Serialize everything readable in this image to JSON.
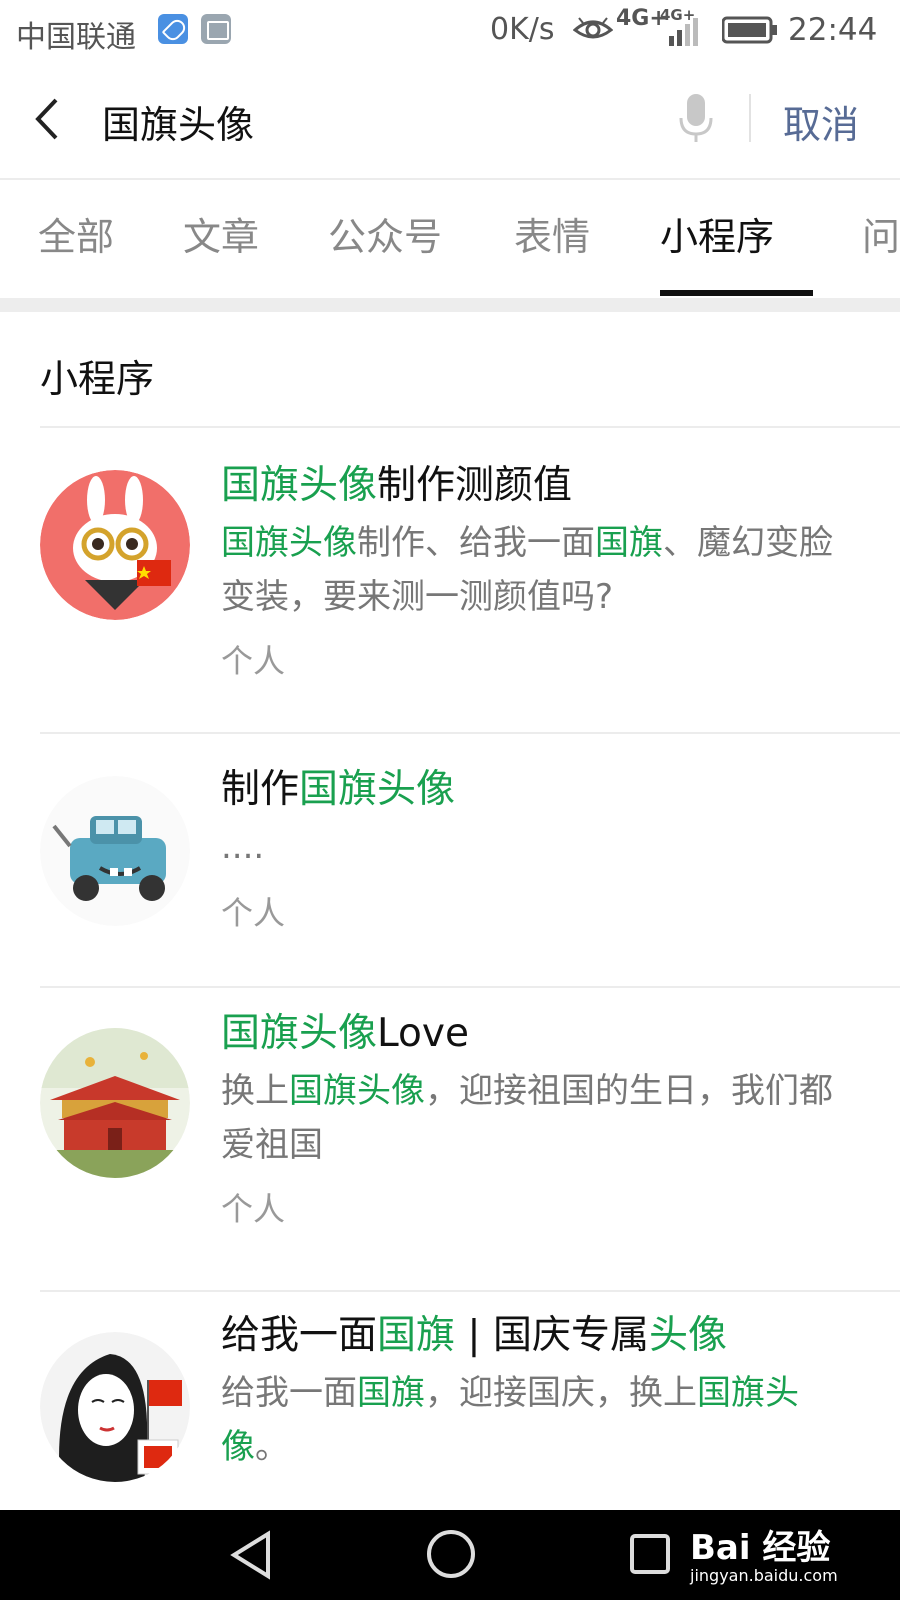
{
  "status_bar": {
    "carrier": "中国联通",
    "speed": "0K/s",
    "network_primary": "4G+",
    "network_secondary": "4G+",
    "time": "22:44",
    "icons": [
      "health-app-icon",
      "gallery-icon",
      "eye-comfort-icon",
      "signal-icon",
      "battery-icon"
    ]
  },
  "search": {
    "query": "国旗头像",
    "cancel_label": "取消",
    "icons": [
      "back-icon",
      "microphone-icon"
    ]
  },
  "tabs": [
    {
      "label": "全部",
      "active": false
    },
    {
      "label": "文章",
      "active": false
    },
    {
      "label": "公众号",
      "active": false
    },
    {
      "label": "表情",
      "active": false
    },
    {
      "label": "小程序",
      "active": true
    },
    {
      "label": "问",
      "active": false
    }
  ],
  "section_title": "小程序",
  "results": [
    {
      "title": [
        {
          "t": "国旗头像",
          "hl": true
        },
        {
          "t": "制作测颜值",
          "hl": false
        }
      ],
      "description": [
        {
          "t": "国旗头像",
          "hl": true
        },
        {
          "t": "制作、给我一面",
          "hl": false
        },
        {
          "t": "国旗",
          "hl": true
        },
        {
          "t": "、魔幻变脸变装，要来测一测颜值吗?",
          "hl": false
        }
      ],
      "tag": "个人",
      "avatar": "rabbit-with-glasses-avatar"
    },
    {
      "title": [
        {
          "t": "制作",
          "hl": false
        },
        {
          "t": "国旗头像",
          "hl": true
        }
      ],
      "description": [
        {
          "t": "....",
          "hl": false
        }
      ],
      "tag": "个人",
      "avatar": "cartoon-tow-truck-avatar"
    },
    {
      "title": [
        {
          "t": "国旗头像",
          "hl": true
        },
        {
          "t": "Love",
          "hl": false
        }
      ],
      "description": [
        {
          "t": "换上",
          "hl": false
        },
        {
          "t": "国旗头像",
          "hl": true
        },
        {
          "t": "，迎接祖国的生日，我们都爱祖国",
          "hl": false
        }
      ],
      "tag": "个人",
      "avatar": "tiananmen-avatar"
    },
    {
      "title": [
        {
          "t": "给我一面",
          "hl": false
        },
        {
          "t": "国旗",
          "hl": true
        },
        {
          "t": " | 国庆专属",
          "hl": false
        },
        {
          "t": "头像",
          "hl": true
        }
      ],
      "description": [
        {
          "t": "给我一面",
          "hl": false
        },
        {
          "t": "国旗",
          "hl": true
        },
        {
          "t": "，迎接国庆，换上",
          "hl": false
        },
        {
          "t": "国旗头",
          "hl": true
        },
        {
          "t": "像",
          "hl": true
        },
        {
          "t": "。",
          "hl": false
        }
      ],
      "tag": "",
      "avatar": "girl-with-flag-avatar"
    }
  ],
  "nav_bar": {
    "icons": [
      "nav-back-icon",
      "nav-home-icon",
      "nav-recent-icon"
    ]
  },
  "watermark": {
    "logo_text": "Bai 经验",
    "url": "jingyan.baidu.com"
  },
  "colors": {
    "highlight": "#19a04f",
    "cancel": "#576b95",
    "tag": "#999999",
    "desc": "#777777"
  }
}
